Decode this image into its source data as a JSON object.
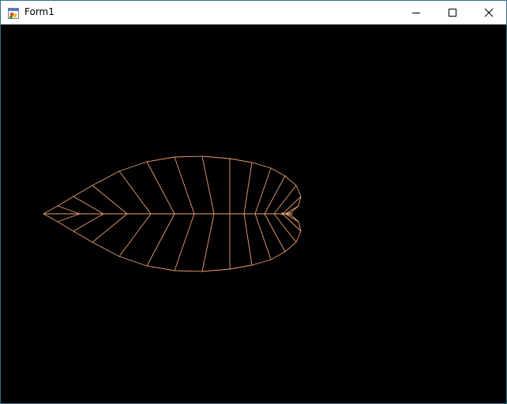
{
  "window": {
    "title": "Form1",
    "title_icon": "winforms-app-icon",
    "controls": {
      "minimize": "minimize-icon",
      "maximize": "maximize-icon",
      "close": "close-icon"
    }
  },
  "canvas": {
    "background": "#000000",
    "stroke_color": "#e8a070",
    "drawing": "leaf-outline-with-veins"
  }
}
